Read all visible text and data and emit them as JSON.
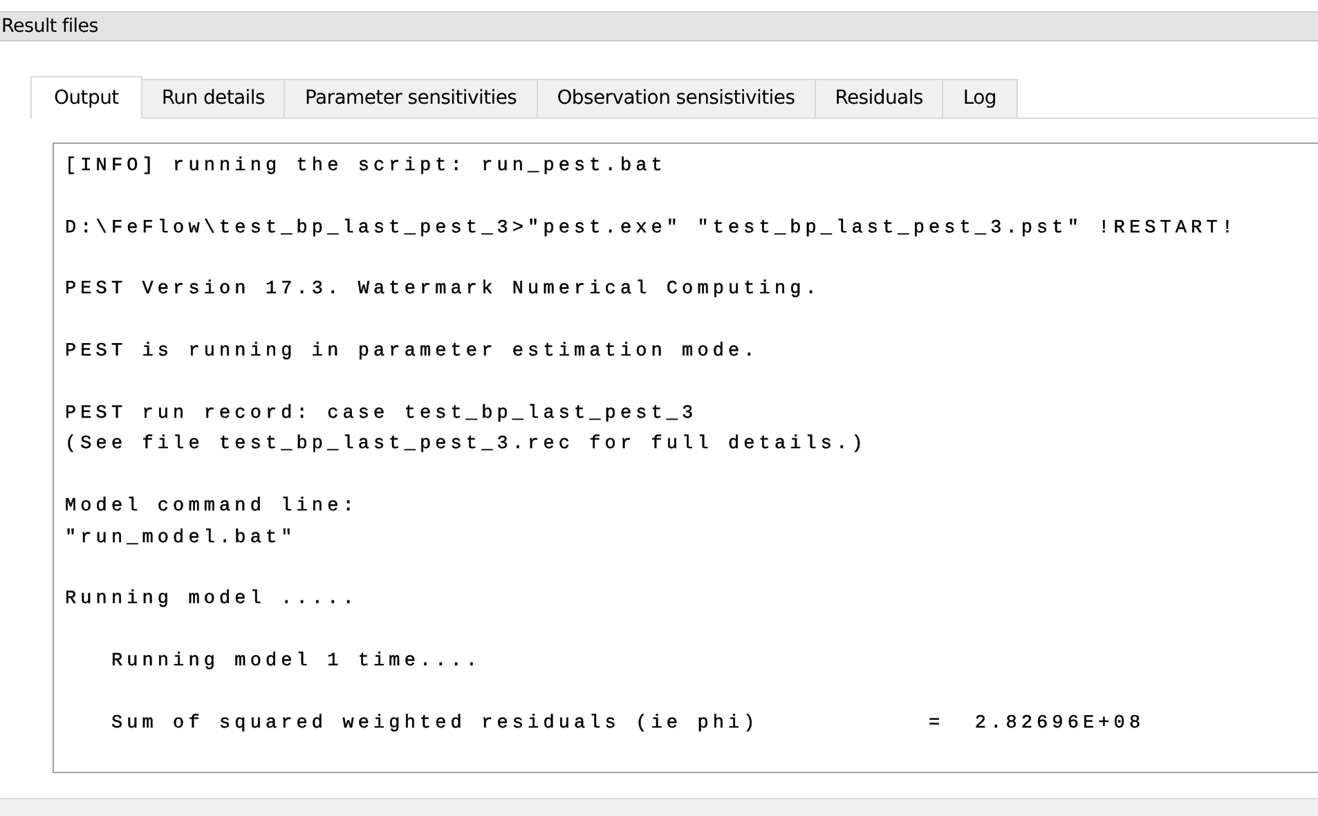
{
  "window": {
    "title": "Result files"
  },
  "tabs": [
    {
      "label": "Output",
      "selected": true
    },
    {
      "label": "Run details",
      "selected": false
    },
    {
      "label": "Parameter sensitivities",
      "selected": false
    },
    {
      "label": "Observation sensistivities",
      "selected": false
    },
    {
      "label": "Residuals",
      "selected": false
    },
    {
      "label": "Log",
      "selected": false
    }
  ],
  "output": {
    "blocks": [
      [
        "[INFO] running the script: run_pest.bat"
      ],
      [
        "D:\\FeFlow\\test_bp_last_pest_3>\"pest.exe\" \"test_bp_last_pest_3.pst\" !RESTART!"
      ],
      [
        "PEST Version 17.3. Watermark Numerical Computing."
      ],
      [
        "PEST is running in parameter estimation mode."
      ],
      [
        "PEST run record: case test_bp_last_pest_3",
        "(See file test_bp_last_pest_3.rec for full details.)"
      ],
      [
        "Model command line:",
        "\"run_model.bat\""
      ],
      [
        "Running model ....."
      ],
      [
        "   Running model 1 time...."
      ],
      [
        "   Sum of squared weighted residuals (ie phi)           =  2.82696E+08"
      ]
    ]
  }
}
